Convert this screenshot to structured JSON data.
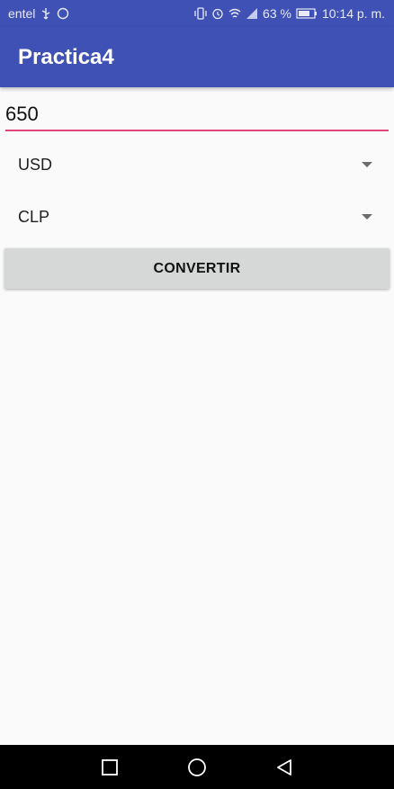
{
  "status_bar": {
    "carrier": "entel",
    "battery_percent": "63 %",
    "time": "10:14 p. m."
  },
  "app": {
    "title": "Practica4"
  },
  "input": {
    "value": "650"
  },
  "spinners": [
    {
      "label": "USD"
    },
    {
      "label": "CLP"
    }
  ],
  "button": {
    "label": "CONVERTIR"
  },
  "colors": {
    "primary": "#3f51b5",
    "accent": "#e0457b",
    "background": "#fafafa",
    "button": "#d6d7d7"
  },
  "nav_icons": [
    "square-icon",
    "circle-icon",
    "triangle-back-icon"
  ]
}
